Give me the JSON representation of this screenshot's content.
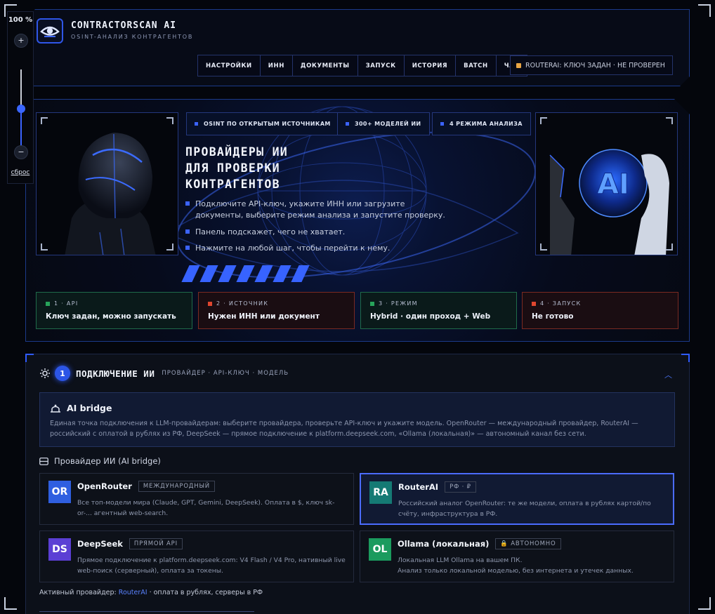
{
  "zoom": {
    "level": "100 %",
    "plus": "+",
    "minus": "−",
    "reset": "сброс",
    "slider_fraction": 0.5
  },
  "header": {
    "title": "CONTRACTORSCAN AI",
    "subtitle": "OSINT-АНАЛИЗ КОНТРАГЕНТОВ",
    "nav": [
      "НАСТРОЙКИ",
      "ИНН",
      "ДОКУМЕНТЫ",
      "ЗАПУСК",
      "ИСТОРИЯ",
      "BATCH",
      "ЧАТ"
    ],
    "router_status": "ROUTERAI: КЛЮЧ ЗАДАН · НЕ ПРОВЕРЕН"
  },
  "hero": {
    "badges": [
      "OSINT ПО ОТКРЫТЫМ ИСТОЧНИКАМ",
      "300+ МОДЕЛЕЙ ИИ",
      "4 РЕЖИМА АНАЛИЗА"
    ],
    "title_lines": [
      "ПРОВАЙДЕРЫ ИИ",
      "ДЛЯ ПРОВЕРКИ",
      "КОНТРАГЕНТОВ"
    ],
    "bullets": [
      "Подключите API-ключ, укажите ИНН или загрузите документы, выберите режим анализа и запустите проверку.",
      "Панель подскажет, чего не хватает.",
      "Нажмите на любой шаг, чтобы перейти к нему."
    ],
    "ai_label": "AI"
  },
  "steps": [
    {
      "label": "1 · API",
      "text": "Ключ задан, можно запускать",
      "color": "#27a35a"
    },
    {
      "label": "2 · ИСТОЧНИК",
      "text": "Нужен ИНН или документ",
      "color": "#e0462f"
    },
    {
      "label": "3 · РЕЖИМ",
      "text": "Hybrid · один проход + Web",
      "color": "#27a35a"
    },
    {
      "label": "4 · ЗАПУСК",
      "text": "Не готово",
      "color": "#e0462f"
    }
  ],
  "connection": {
    "number": "1",
    "title": "ПОДКЛЮЧЕНИЕ ИИ",
    "subtitle": "ПРОВАЙДЕР · API-КЛЮЧ · МОДЕЛЬ",
    "bridge": {
      "title": "AI bridge",
      "description": "Единая точка подключения к LLM-провайдерам: выберите провайдера, проверьте API-ключ и укажите модель. OpenRouter — международный провайдер, RouterAI — российский с оплатой в рублях из РФ, DeepSeek — прямое подключение к platform.deepseek.com, «Ollama (локальная)» — автономный канал без сети."
    },
    "providers_heading": "Провайдер ИИ (AI bridge)",
    "providers": [
      {
        "abbr": "OR",
        "name": "OpenRouter",
        "tag": "МЕЖДУНАРОДНЫЙ",
        "desc": "Все топ-модели мира (Claude, GPT, Gemini, DeepSeek). Оплата в $, ключ sk-or-... агентный web-search.",
        "color": "#2f5fe0"
      },
      {
        "abbr": "RA",
        "name": "RouterAI",
        "tag": "РФ · ₽",
        "desc": "Российский аналог OpenRouter: те же модели, оплата в рублях картой/по счёту, инфраструктура в РФ.",
        "color": "#157a74"
      },
      {
        "abbr": "DS",
        "name": "DeepSeek",
        "tag": "ПРЯМОЙ API",
        "desc": "Прямое подключение к platform.deepseek.com: V4 Flash / V4 Pro, нативный live web-поиск (серверный), оплата за токены.",
        "color": "#5b3fd4"
      },
      {
        "abbr": "OL",
        "name": "Ollama (локальная)",
        "tag": "АВТОНОМНО",
        "desc_lines": [
          "Локальная LLM Ollama на вашем ПК.",
          "Анализ только локальной моделью, без интернета и утечек данных."
        ],
        "color": "#1b9b5e"
      }
    ],
    "active_prefix": "Активный провайдер: ",
    "active_name": "RouterAI",
    "active_suffix": " · оплата в рублях, серверы в РФ"
  }
}
